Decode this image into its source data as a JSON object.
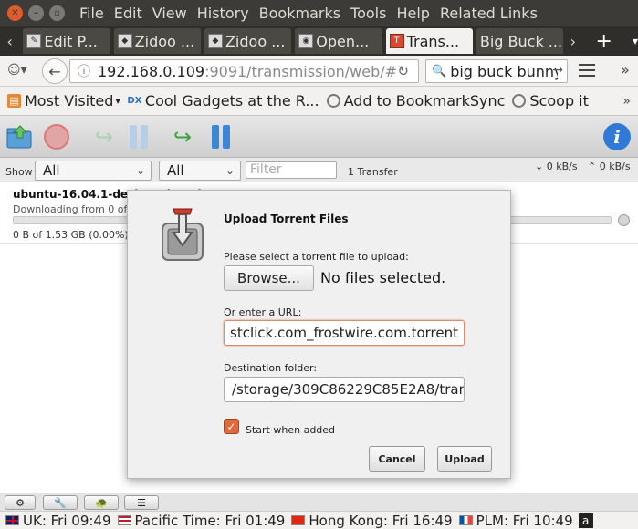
{
  "menubar": {
    "items": [
      "File",
      "Edit",
      "View",
      "History",
      "Bookmarks",
      "Tools",
      "Help",
      "Related Links"
    ]
  },
  "tabs": [
    {
      "label": "Edit P..."
    },
    {
      "label": "Zidoo ..."
    },
    {
      "label": "Zidoo ..."
    },
    {
      "label": "Open..."
    },
    {
      "label": "Trans..."
    },
    {
      "label": "Big Buck ..."
    }
  ],
  "navbar": {
    "url_host": "192.168.0.109",
    "url_rest": ":9091/transmission/web/#",
    "search_value": "big buck bunny"
  },
  "bookmarks": [
    {
      "label": "Most Visited",
      "icon": "folder-icon"
    },
    {
      "label": "Cool Gadgets at the R...",
      "icon": "dx-icon"
    },
    {
      "label": "Add to BookmarkSync",
      "icon": "globe-icon"
    },
    {
      "label": "Scoop it",
      "icon": "globe-icon"
    }
  ],
  "filter": {
    "show_label": "Show",
    "state_value": "All",
    "tracker_value": "All",
    "filter_placeholder": "Filter",
    "transfer_count": "1 Transfer",
    "down_speed": "0 kB/s",
    "up_speed": "0 kB/s"
  },
  "torrent": {
    "name": "ubuntu-16.04.1-desktop-i386.iso",
    "peers": "Downloading from 0 of 0 connected peers",
    "progress_text": "0 B of 1.53 GB (0.00%)",
    "progress_fraction": 0
  },
  "dialog": {
    "title": "Upload Torrent Files",
    "file_prompt": "Please select a torrent file to upload:",
    "browse_label": "Browse...",
    "no_file_text": "No files selected.",
    "url_prompt": "Or enter a URL:",
    "url_value": "stclick.com_frostwire.com.torrent",
    "dest_prompt": "Destination folder:",
    "dest_value": "/storage/309C86229C85E2A8/tran",
    "start_label": "Start when added",
    "start_checked": true,
    "cancel_label": "Cancel",
    "upload_label": "Upload"
  },
  "clocks": [
    {
      "flag": "uk",
      "label": "UK: Fri 09:49"
    },
    {
      "flag": "us",
      "label": "Pacific Time: Fri 01:49"
    },
    {
      "flag": "hk",
      "label": "Hong Kong: Fri 16:49"
    },
    {
      "flag": "fr",
      "label": "PLM: Fri 10:49"
    }
  ],
  "colors": {
    "menubar_bg": "#3c3b37",
    "close_button": "#e25a2c",
    "accent_blue": "#2f7ad6",
    "checkbox_orange": "#e06a3c"
  }
}
